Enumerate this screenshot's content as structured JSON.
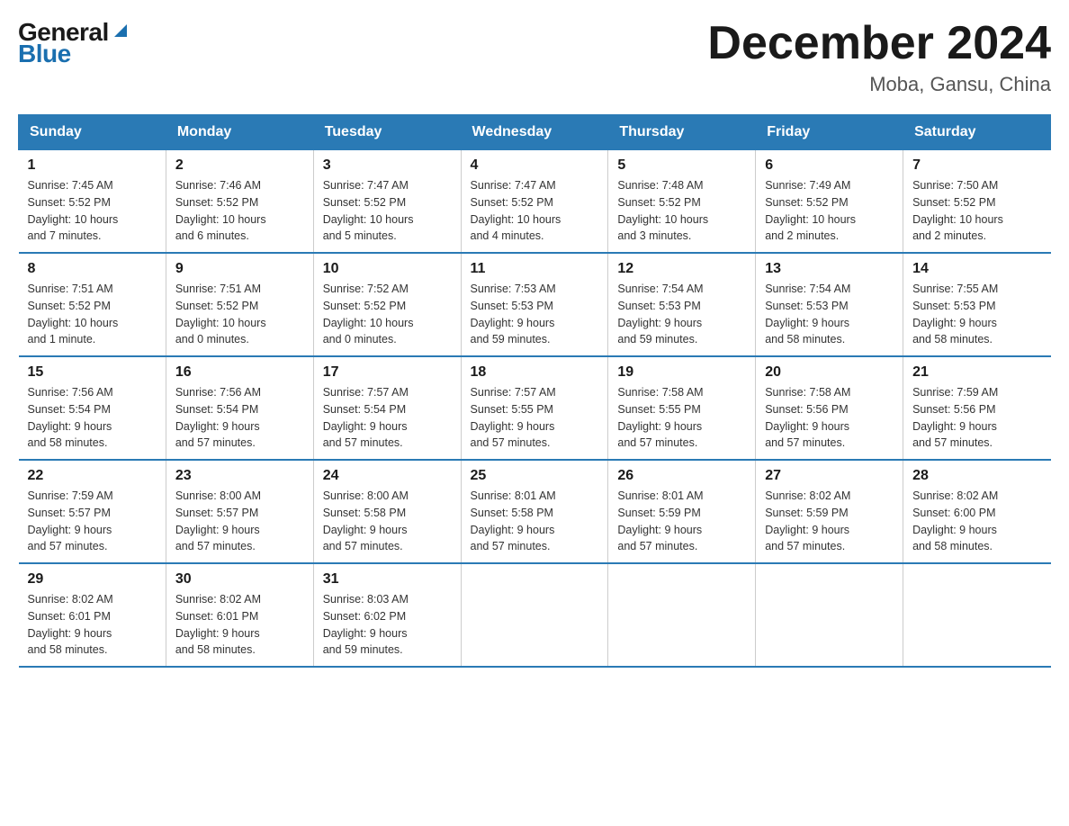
{
  "logo": {
    "general": "General",
    "blue": "Blue",
    "triangle": "▲"
  },
  "title": "December 2024",
  "location": "Moba, Gansu, China",
  "weekdays": [
    "Sunday",
    "Monday",
    "Tuesday",
    "Wednesday",
    "Thursday",
    "Friday",
    "Saturday"
  ],
  "weeks": [
    [
      {
        "day": "1",
        "sunrise": "7:45 AM",
        "sunset": "5:52 PM",
        "daylight": "10 hours and 7 minutes."
      },
      {
        "day": "2",
        "sunrise": "7:46 AM",
        "sunset": "5:52 PM",
        "daylight": "10 hours and 6 minutes."
      },
      {
        "day": "3",
        "sunrise": "7:47 AM",
        "sunset": "5:52 PM",
        "daylight": "10 hours and 5 minutes."
      },
      {
        "day": "4",
        "sunrise": "7:47 AM",
        "sunset": "5:52 PM",
        "daylight": "10 hours and 4 minutes."
      },
      {
        "day": "5",
        "sunrise": "7:48 AM",
        "sunset": "5:52 PM",
        "daylight": "10 hours and 3 minutes."
      },
      {
        "day": "6",
        "sunrise": "7:49 AM",
        "sunset": "5:52 PM",
        "daylight": "10 hours and 2 minutes."
      },
      {
        "day": "7",
        "sunrise": "7:50 AM",
        "sunset": "5:52 PM",
        "daylight": "10 hours and 2 minutes."
      }
    ],
    [
      {
        "day": "8",
        "sunrise": "7:51 AM",
        "sunset": "5:52 PM",
        "daylight": "10 hours and 1 minute."
      },
      {
        "day": "9",
        "sunrise": "7:51 AM",
        "sunset": "5:52 PM",
        "daylight": "10 hours and 0 minutes."
      },
      {
        "day": "10",
        "sunrise": "7:52 AM",
        "sunset": "5:52 PM",
        "daylight": "10 hours and 0 minutes."
      },
      {
        "day": "11",
        "sunrise": "7:53 AM",
        "sunset": "5:53 PM",
        "daylight": "9 hours and 59 minutes."
      },
      {
        "day": "12",
        "sunrise": "7:54 AM",
        "sunset": "5:53 PM",
        "daylight": "9 hours and 59 minutes."
      },
      {
        "day": "13",
        "sunrise": "7:54 AM",
        "sunset": "5:53 PM",
        "daylight": "9 hours and 58 minutes."
      },
      {
        "day": "14",
        "sunrise": "7:55 AM",
        "sunset": "5:53 PM",
        "daylight": "9 hours and 58 minutes."
      }
    ],
    [
      {
        "day": "15",
        "sunrise": "7:56 AM",
        "sunset": "5:54 PM",
        "daylight": "9 hours and 58 minutes."
      },
      {
        "day": "16",
        "sunrise": "7:56 AM",
        "sunset": "5:54 PM",
        "daylight": "9 hours and 57 minutes."
      },
      {
        "day": "17",
        "sunrise": "7:57 AM",
        "sunset": "5:54 PM",
        "daylight": "9 hours and 57 minutes."
      },
      {
        "day": "18",
        "sunrise": "7:57 AM",
        "sunset": "5:55 PM",
        "daylight": "9 hours and 57 minutes."
      },
      {
        "day": "19",
        "sunrise": "7:58 AM",
        "sunset": "5:55 PM",
        "daylight": "9 hours and 57 minutes."
      },
      {
        "day": "20",
        "sunrise": "7:58 AM",
        "sunset": "5:56 PM",
        "daylight": "9 hours and 57 minutes."
      },
      {
        "day": "21",
        "sunrise": "7:59 AM",
        "sunset": "5:56 PM",
        "daylight": "9 hours and 57 minutes."
      }
    ],
    [
      {
        "day": "22",
        "sunrise": "7:59 AM",
        "sunset": "5:57 PM",
        "daylight": "9 hours and 57 minutes."
      },
      {
        "day": "23",
        "sunrise": "8:00 AM",
        "sunset": "5:57 PM",
        "daylight": "9 hours and 57 minutes."
      },
      {
        "day": "24",
        "sunrise": "8:00 AM",
        "sunset": "5:58 PM",
        "daylight": "9 hours and 57 minutes."
      },
      {
        "day": "25",
        "sunrise": "8:01 AM",
        "sunset": "5:58 PM",
        "daylight": "9 hours and 57 minutes."
      },
      {
        "day": "26",
        "sunrise": "8:01 AM",
        "sunset": "5:59 PM",
        "daylight": "9 hours and 57 minutes."
      },
      {
        "day": "27",
        "sunrise": "8:02 AM",
        "sunset": "5:59 PM",
        "daylight": "9 hours and 57 minutes."
      },
      {
        "day": "28",
        "sunrise": "8:02 AM",
        "sunset": "6:00 PM",
        "daylight": "9 hours and 58 minutes."
      }
    ],
    [
      {
        "day": "29",
        "sunrise": "8:02 AM",
        "sunset": "6:01 PM",
        "daylight": "9 hours and 58 minutes."
      },
      {
        "day": "30",
        "sunrise": "8:02 AM",
        "sunset": "6:01 PM",
        "daylight": "9 hours and 58 minutes."
      },
      {
        "day": "31",
        "sunrise": "8:03 AM",
        "sunset": "6:02 PM",
        "daylight": "9 hours and 59 minutes."
      },
      null,
      null,
      null,
      null
    ]
  ],
  "labels": {
    "sunrise": "Sunrise:",
    "sunset": "Sunset:",
    "daylight": "Daylight:"
  }
}
